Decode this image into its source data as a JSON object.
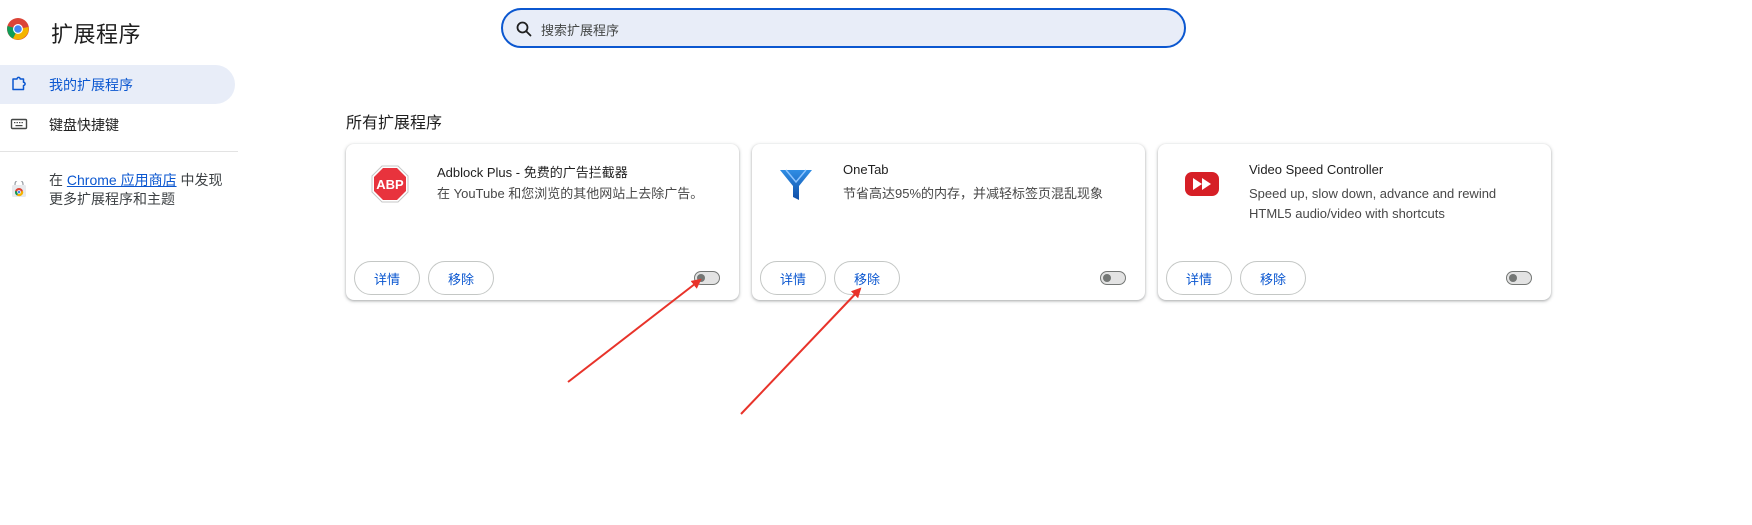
{
  "app": {
    "title": "扩展程序"
  },
  "sidebar": {
    "items": [
      {
        "label": "我的扩展程序",
        "icon": "extension-icon",
        "active": true
      },
      {
        "label": "键盘快捷键",
        "icon": "keyboard-icon",
        "active": false
      }
    ],
    "store_prefix": "在 ",
    "store_link": "Chrome 应用商店",
    "store_suffix": " 中发现更多扩展程序和主题"
  },
  "search": {
    "placeholder": "搜索扩展程序",
    "value": ""
  },
  "main": {
    "section_title": "所有扩展程序",
    "cards": [
      {
        "name": "Adblock Plus - 免费的广告拦截器",
        "description": "在 YouTube 和您浏览的其他网站上去除广告。",
        "icon": "abp-icon",
        "details_label": "详情",
        "remove_label": "移除",
        "enabled": false
      },
      {
        "name": "OneTab",
        "description": "节省高达95%的内存，并减轻标签页混乱现象",
        "icon": "onetab-funnel-icon",
        "details_label": "详情",
        "remove_label": "移除",
        "enabled": false
      },
      {
        "name": "Video Speed Controller",
        "description": "Speed up, slow down, advance and rewind HTML5 audio/video with shortcuts",
        "icon": "fast-forward-icon",
        "details_label": "详情",
        "remove_label": "移除",
        "enabled": false
      }
    ]
  },
  "colors": {
    "accent": "#0b57d0",
    "active_bg": "#e8edf8",
    "annotation_arrow": "#e8332a"
  }
}
